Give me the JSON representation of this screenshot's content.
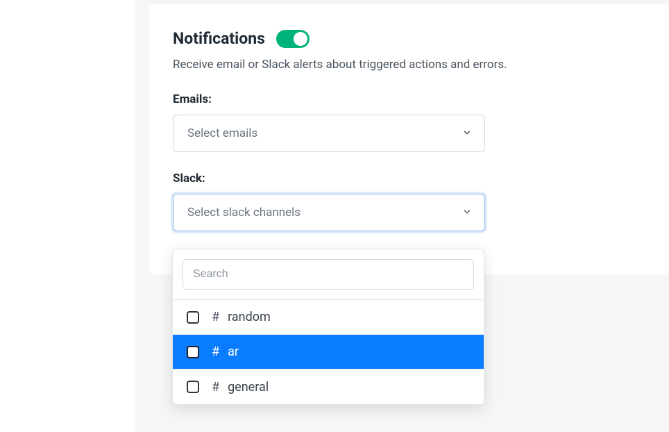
{
  "notifications": {
    "title": "Notifications",
    "description": "Receive email or Slack alerts about triggered actions and errors.",
    "emails_label": "Emails:",
    "emails_placeholder": "Select emails",
    "slack_label": "Slack:",
    "slack_placeholder": "Select slack channels"
  },
  "dropdown": {
    "search_placeholder": "Search",
    "options": [
      {
        "hash": "#",
        "name": "random",
        "highlighted": false
      },
      {
        "hash": "#",
        "name": "ar",
        "highlighted": true
      },
      {
        "hash": "#",
        "name": "general",
        "highlighted": false
      }
    ]
  }
}
